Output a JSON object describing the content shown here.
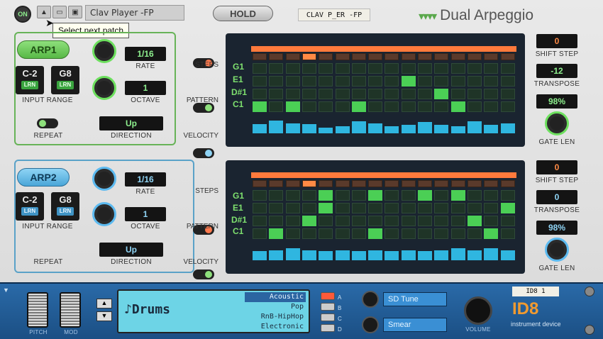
{
  "window": {
    "power_label": "ON",
    "patch_name": "Clav Player -FP",
    "tooltip": "Select next patch",
    "hold_label": "HOLD",
    "tape_label": "CLAV P_ER -FP",
    "device_title": "Dual Arpeggio"
  },
  "arp1": {
    "label": "ARP1",
    "range_low": "C-2",
    "range_high": "G8",
    "lrn": "LRN",
    "input_range_caption": "INPUT RANGE",
    "rate_value": "1/16",
    "rate_caption": "RATE",
    "octave_value": "1",
    "octave_caption": "OCTAVE",
    "repeat_caption": "REPEAT",
    "direction_value": "Up",
    "direction_caption": "DIRECTION",
    "steps_caption": "STEPS",
    "pattern_caption": "PATTERN",
    "velocity_caption": "VELOCITY",
    "notes": [
      "G1",
      "E1",
      "D#1",
      "C1"
    ],
    "shift_step_value": "0",
    "shift_step_caption": "SHIFT STEP",
    "transpose_value": "-12",
    "transpose_caption": "TRANSPOSE",
    "gate_value": "98%",
    "gate_caption": "GATE LEN",
    "active_step": 3,
    "pattern_rows": [
      [
        0,
        0,
        0,
        0,
        0,
        0,
        0,
        0,
        0,
        0,
        0,
        0,
        0,
        0,
        0,
        0
      ],
      [
        0,
        0,
        0,
        0,
        0,
        0,
        0,
        0,
        0,
        1,
        0,
        0,
        0,
        0,
        0,
        0
      ],
      [
        0,
        0,
        0,
        0,
        0,
        0,
        0,
        0,
        0,
        0,
        0,
        1,
        0,
        0,
        0,
        0
      ],
      [
        1,
        0,
        1,
        0,
        0,
        0,
        1,
        0,
        0,
        0,
        0,
        0,
        1,
        0,
        0,
        0
      ]
    ],
    "velocities": [
      0.5,
      0.7,
      0.55,
      0.5,
      0.3,
      0.4,
      0.65,
      0.55,
      0.4,
      0.45,
      0.6,
      0.45,
      0.4,
      0.65,
      0.45,
      0.55
    ]
  },
  "arp2": {
    "label": "ARP2",
    "range_low": "C-2",
    "range_high": "G8",
    "lrn": "LRN",
    "input_range_caption": "INPUT RANGE",
    "rate_value": "1/16",
    "rate_caption": "RATE",
    "octave_value": "1",
    "octave_caption": "OCTAVE",
    "repeat_caption": "REPEAT",
    "direction_value": "Up",
    "direction_caption": "DIRECTION",
    "steps_caption": "STEPS",
    "pattern_caption": "PATTERN",
    "velocity_caption": "VELOCITY",
    "notes": [
      "G1",
      "E1",
      "D#1",
      "C1"
    ],
    "shift_step_value": "0",
    "shift_step_caption": "SHIFT STEP",
    "transpose_value": "0",
    "transpose_caption": "TRANSPOSE",
    "gate_value": "98%",
    "gate_caption": "GATE LEN",
    "active_step": 3,
    "pattern_rows": [
      [
        0,
        0,
        0,
        0,
        1,
        0,
        0,
        1,
        0,
        0,
        1,
        0,
        1,
        0,
        0,
        0
      ],
      [
        0,
        0,
        0,
        0,
        1,
        0,
        0,
        0,
        0,
        0,
        0,
        0,
        0,
        0,
        0,
        1
      ],
      [
        0,
        0,
        0,
        1,
        0,
        0,
        0,
        0,
        0,
        0,
        0,
        0,
        0,
        1,
        0,
        0
      ],
      [
        0,
        1,
        0,
        0,
        0,
        0,
        0,
        1,
        0,
        0,
        0,
        0,
        0,
        0,
        1,
        0
      ]
    ],
    "velocities": [
      0.5,
      0.55,
      0.65,
      0.55,
      0.5,
      0.55,
      0.5,
      0.55,
      0.5,
      0.55,
      0.5,
      0.55,
      0.65,
      0.55,
      0.65,
      0.55
    ]
  },
  "id8": {
    "pitch_caption": "PITCH",
    "mod_caption": "MOD",
    "category": "♪Drums",
    "presets": [
      "Acoustic",
      "Pop",
      "RnB-HipHop",
      "Electronic"
    ],
    "selected_preset": 0,
    "preset_letters": [
      "A",
      "B",
      "C",
      "D"
    ],
    "ctl1_label": "SD Tune",
    "ctl2_label": "Smear",
    "volume_caption": "VOLUME",
    "tape_label": "ID8 1",
    "brand": "ID8",
    "brand_sub": "instrument device"
  },
  "colors": {
    "green": "#4bcf55",
    "blue": "#2fb6e0",
    "orange": "#ff8a45",
    "panel": "#1a2430"
  }
}
